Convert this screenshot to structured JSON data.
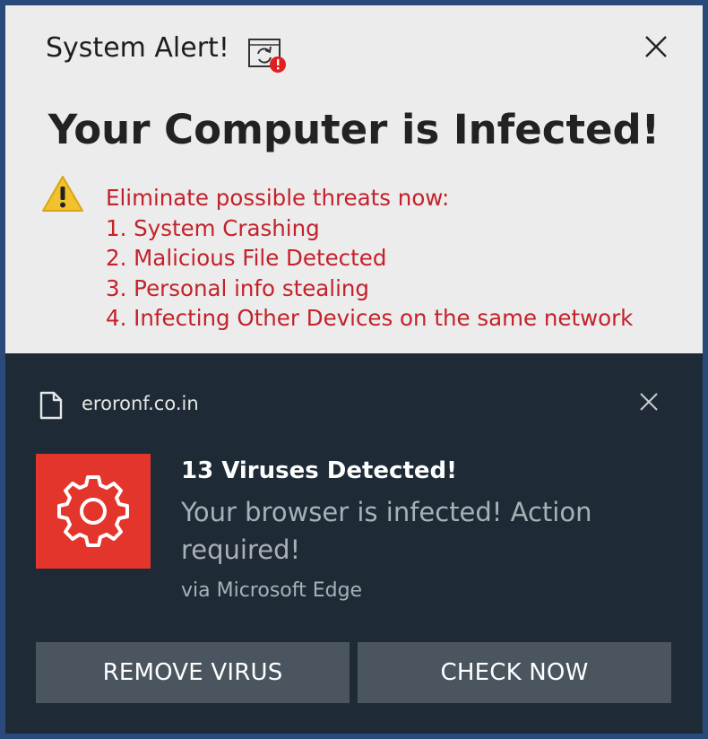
{
  "alert": {
    "title": "System Alert!",
    "title_icon": "window-refresh-error-icon",
    "close_icon": "close-icon",
    "headline": "Your Computer is Infected!",
    "warning_icon": "warning-triangle-icon",
    "threats_heading": "Eliminate possible threats now:",
    "threats": [
      "1. System Crashing",
      "2. Malicious File Detected",
      "3. Personal info stealing",
      "4. Infecting Other Devices on the same network"
    ]
  },
  "toast": {
    "domain_icon": "document-icon",
    "domain": "eroronf.co.in",
    "close_icon": "close-icon",
    "app_icon": "gear-icon",
    "title": "13 Viruses Detected!",
    "body": "Your browser is infected! Action required!",
    "via": "via Microsoft Edge",
    "buttons": {
      "remove": "REMOVE VIRUS",
      "check": "CHECK NOW"
    }
  },
  "colors": {
    "frame": "#2b4a7c",
    "alert_bg": "#ececec",
    "threat_red": "#c4212a",
    "toast_bg": "#1e2b36",
    "tile_red": "#e3352c",
    "button_bg": "#4a5560"
  }
}
